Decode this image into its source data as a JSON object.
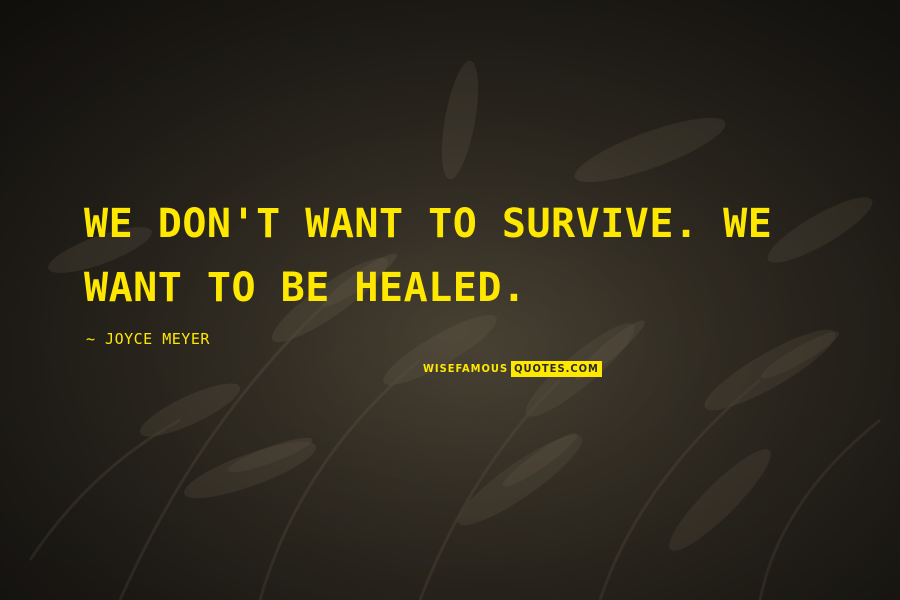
{
  "quote": {
    "text": "WE DON'T WANT TO SURVIVE. WE WANT TO BE HEALED.",
    "author": "~ JOYCE MEYER"
  },
  "watermark": {
    "part1": "WISEFAMOUS",
    "part2": "QUOTES.COM"
  },
  "colors": {
    "text": "#ffe800",
    "background": "#2e2a22"
  }
}
